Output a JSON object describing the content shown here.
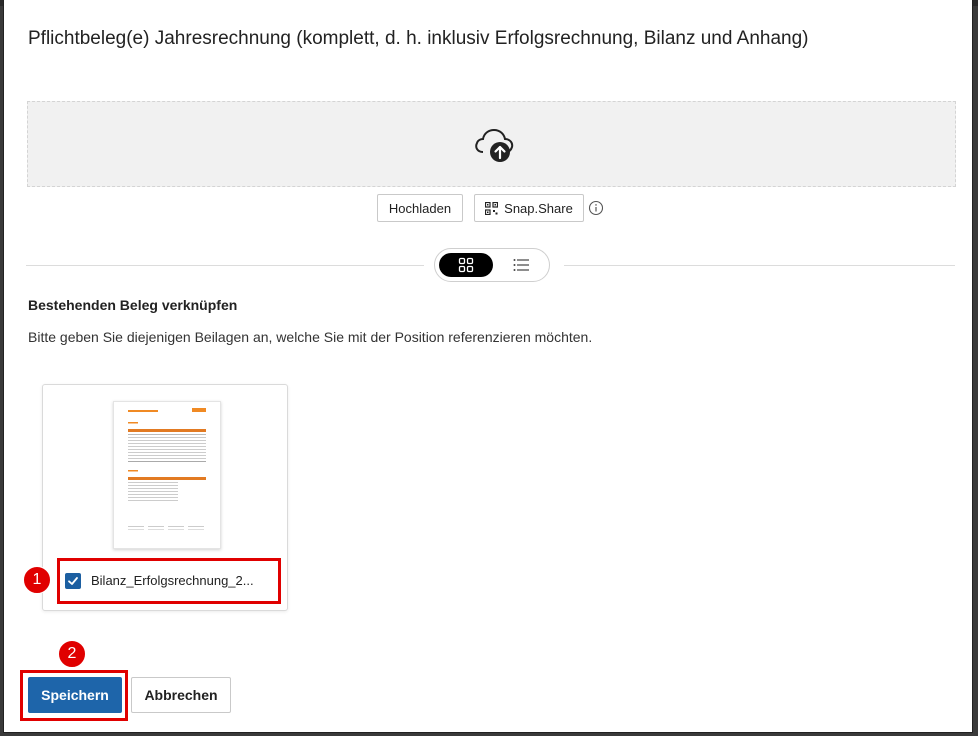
{
  "dialog": {
    "title": "Pflichtbeleg(e) Jahresrechnung (komplett, d. h. inklusiv Erfolgsrechnung, Bilanz und Anhang)"
  },
  "upload": {
    "icon": "cloud-upload-icon",
    "upload_label": "Hochladen",
    "snap_label": "Snap.Share",
    "snap_icon": "qr-code-icon",
    "info_icon": "info-icon"
  },
  "view_toggle": {
    "active": "grid",
    "grid_icon": "grid-view-icon",
    "list_icon": "list-view-icon"
  },
  "link_section": {
    "title": "Bestehenden Beleg verknüpfen",
    "description": "Bitte geben Sie diejenigen Beilagen an, welche Sie mit der Position referenzieren möchten."
  },
  "documents": [
    {
      "filename": "Bilanz_Erfolgsrechnung_2...",
      "checked": true
    }
  ],
  "annotations": {
    "marker_1": "1",
    "marker_2": "2",
    "highlight_color": "#e00000"
  },
  "footer": {
    "save_label": "Speichern",
    "cancel_label": "Abbrechen"
  },
  "colors": {
    "primary": "#1e65aa",
    "accent_orange": "#f08a24"
  }
}
